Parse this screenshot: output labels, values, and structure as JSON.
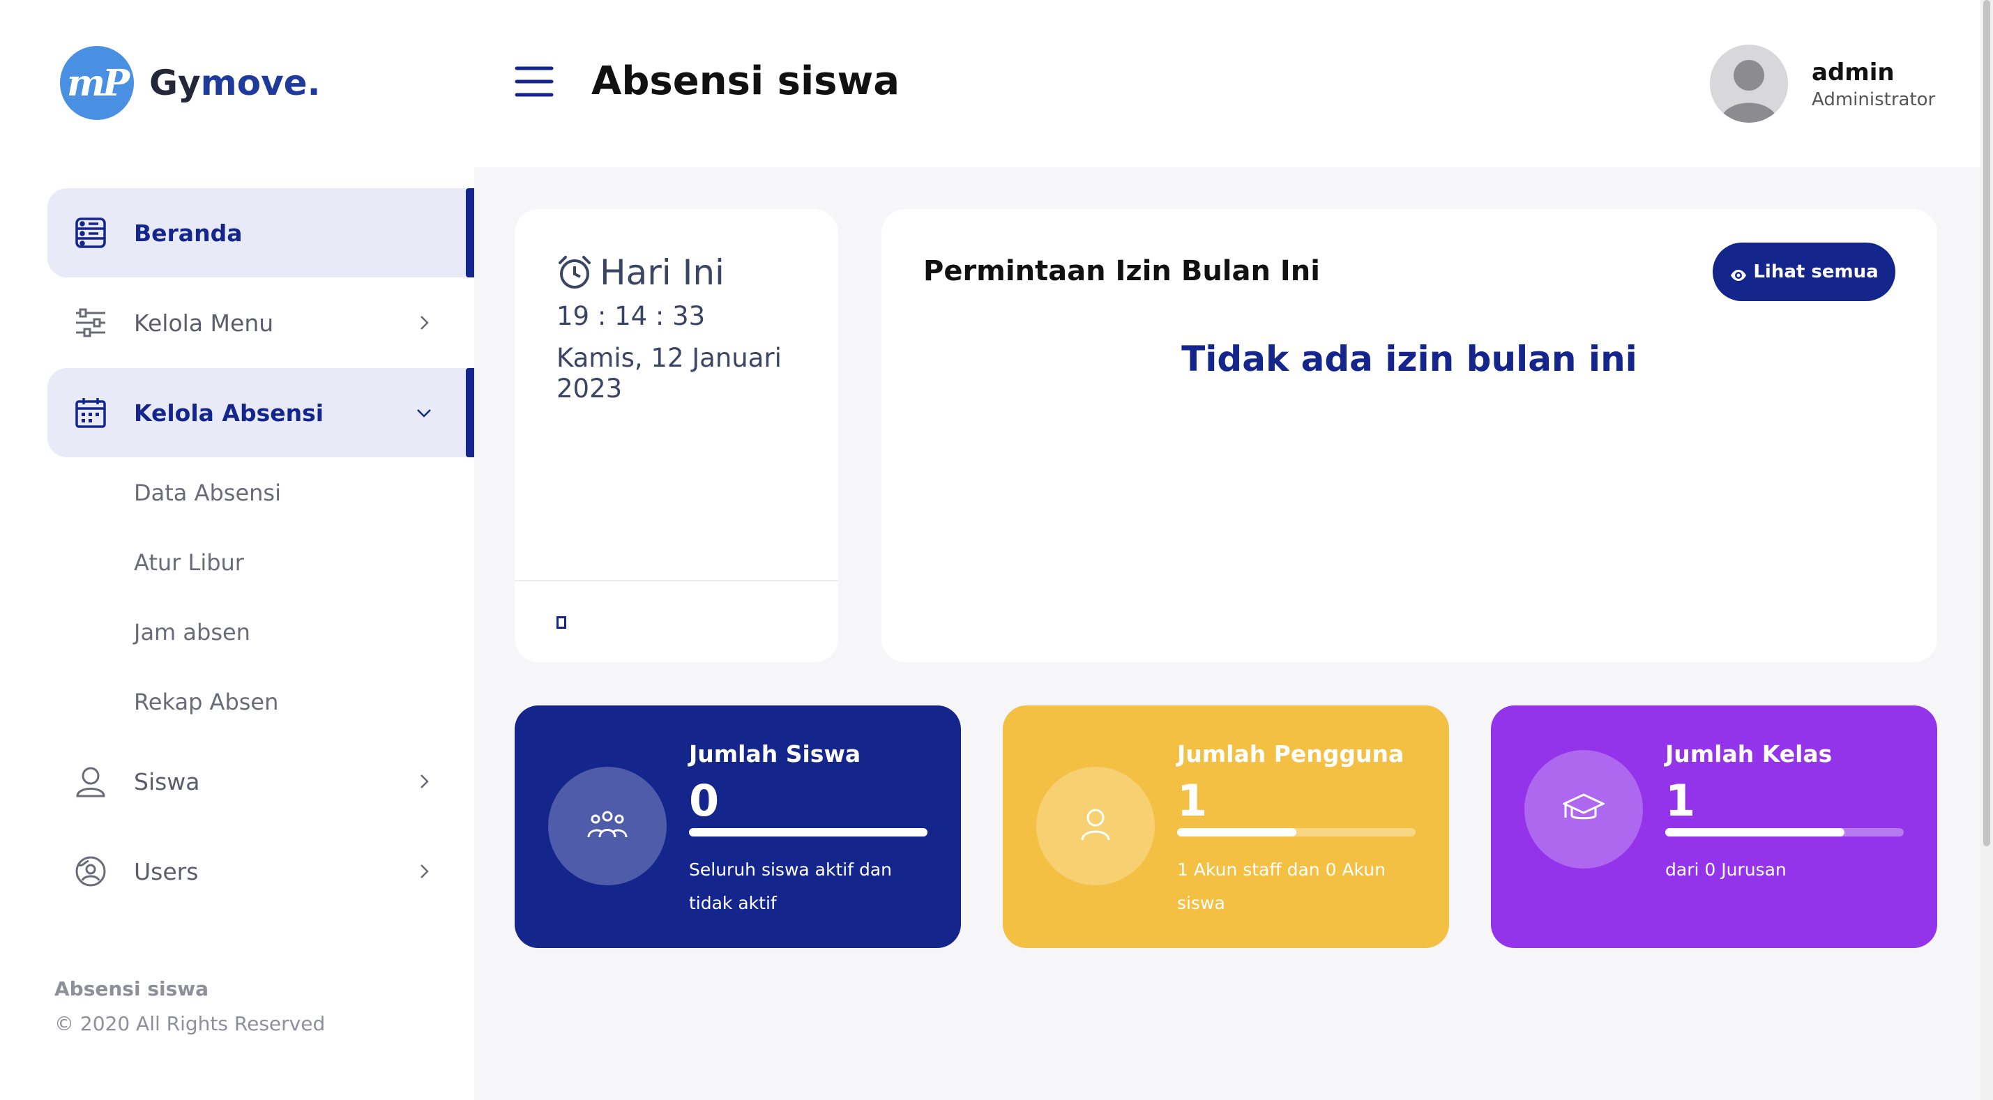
{
  "brand": {
    "logo_text": "mP",
    "name_prefix": "Gy",
    "name_suffix": "move."
  },
  "sidebar": {
    "items": [
      {
        "label": "Beranda",
        "icon": "dashboard-icon",
        "active": true
      },
      {
        "label": "Kelola Menu",
        "icon": "sliders-icon",
        "arrow": "chevron-right-icon"
      },
      {
        "label": "Kelola Absensi",
        "icon": "calendar-icon",
        "active": true,
        "arrow": "chevron-down-icon"
      },
      {
        "label": "Siswa",
        "icon": "user-icon",
        "arrow": "chevron-right-icon"
      },
      {
        "label": "Users",
        "icon": "globe-user-icon",
        "arrow": "chevron-right-icon"
      }
    ],
    "submenu": [
      "Data Absensi",
      "Atur Libur",
      "Jam absen",
      "Rekap Absen"
    ],
    "footer_title": "Absensi siswa",
    "footer_copy": "© 2020 All Rights Reserved"
  },
  "header": {
    "title": "Absensi siswa",
    "user_name": "admin",
    "user_role": "Administrator"
  },
  "today": {
    "title": "Hari Ini",
    "time": "19 : 14 : 33",
    "date": "Kamis, 12 Januari 2023"
  },
  "izin": {
    "title": "Permintaan Izin Bulan Ini",
    "button": "Lihat semua",
    "empty": "Tidak ada izin bulan ini"
  },
  "stats": [
    {
      "label": "Jumlah Siswa",
      "value": "0",
      "desc": "Seluruh siswa aktif dan tidak aktif",
      "progress": 1.0,
      "color": "#14268c",
      "icon": "group-icon"
    },
    {
      "label": "Jumlah Pengguna",
      "value": "1",
      "desc": "1 Akun staff dan 0 Akun siswa",
      "progress": 0.5,
      "color": "#f4c043",
      "icon": "person-icon"
    },
    {
      "label": "Jumlah Kelas",
      "value": "1",
      "desc": "dari 0 Jurusan",
      "progress": 0.75,
      "color": "#9334ea",
      "icon": "graduation-cap-icon"
    }
  ],
  "colors": {
    "primary": "#14268c",
    "active_bg": "#e8ebf7"
  }
}
